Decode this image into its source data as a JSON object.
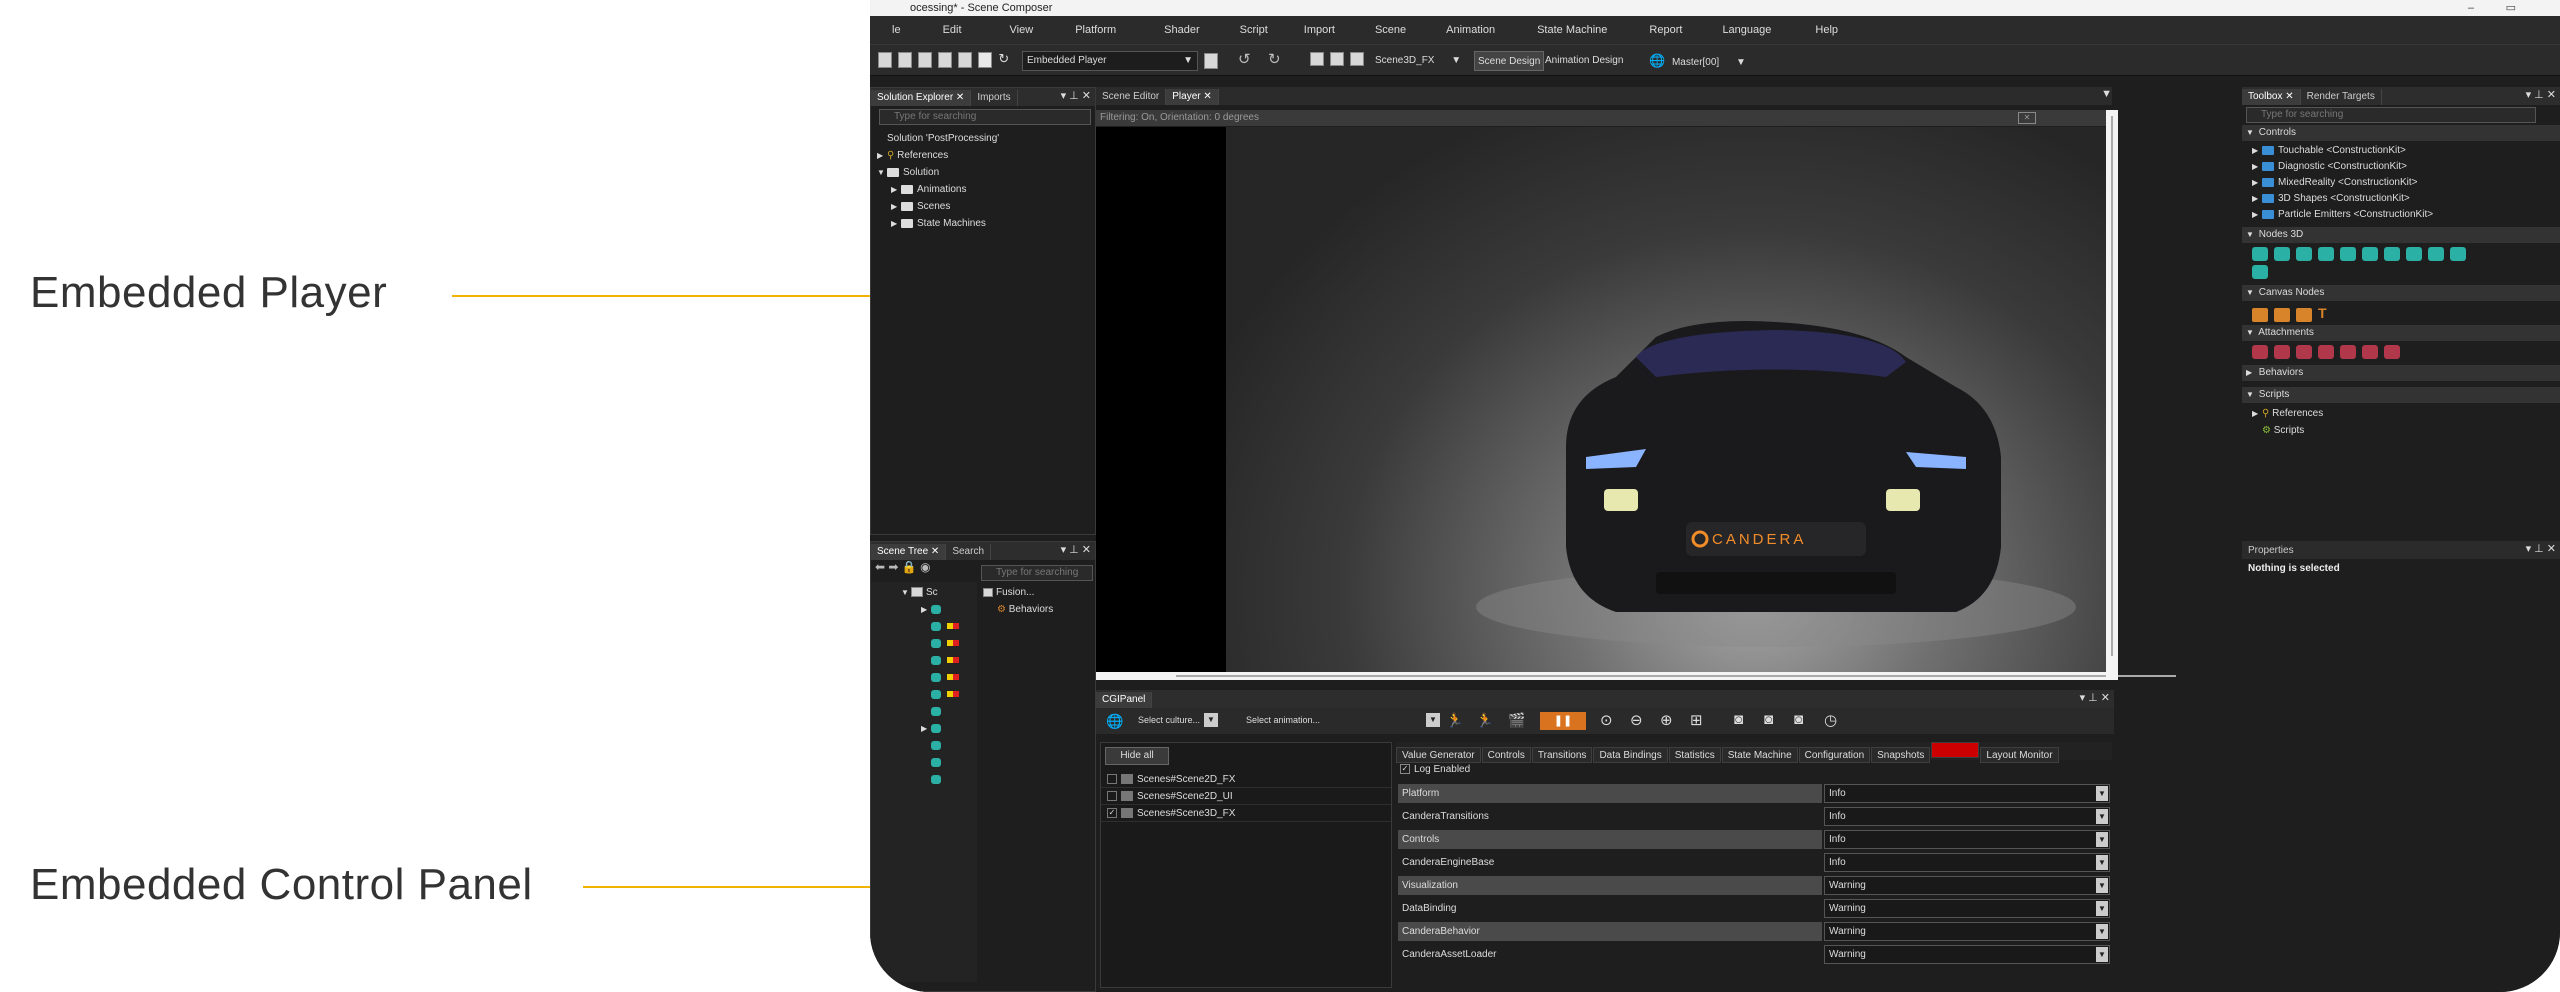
{
  "callouts": {
    "player": "Embedded Player",
    "control_panel": "Embedded Control Panel"
  },
  "window": {
    "title": "ocessing* - Scene Composer",
    "menu": [
      "le",
      "Edit",
      "View",
      "Platform",
      "Shader",
      "Script",
      "Import",
      "Scene",
      "Animation",
      "State Machine",
      "Report",
      "Language",
      "Help"
    ],
    "toolbar": {
      "player_select": "Embedded Player",
      "scene_select": "Scene3D_FX",
      "scene_design": "Scene Design",
      "animation_design": "Animation Design",
      "master_select": "Master[00]"
    }
  },
  "solution_explorer": {
    "tabs": [
      "Solution Explorer",
      "Imports"
    ],
    "search_placeholder": "Type for searching",
    "items": [
      {
        "label": "Solution 'PostProcessing'"
      },
      {
        "label": "References"
      },
      {
        "label": "Solution"
      },
      {
        "label": "Animations"
      },
      {
        "label": "Scenes"
      },
      {
        "label": "State Machines"
      }
    ]
  },
  "scene_tree": {
    "tabs": [
      "Scene Tree",
      "Search"
    ],
    "search_placeholder": "Type for searching",
    "root_label": "Sc",
    "right_items": [
      "Fusion...",
      "Behaviors"
    ]
  },
  "editor": {
    "tabs": [
      "Scene Editor",
      "Player"
    ],
    "filter_text": "Filtering: On, Orientation: 0 degrees",
    "car_brand": "CANDERA"
  },
  "cgi_panel": {
    "title": "CGIPanel",
    "culture_placeholder": "Select culture...",
    "animation_placeholder": "Select animation...",
    "hide_all": "Hide all",
    "scenes": [
      {
        "label": "Scenes#Scene2D_FX",
        "checked": false
      },
      {
        "label": "Scenes#Scene2D_UI",
        "checked": false
      },
      {
        "label": "Scenes#Scene3D_FX",
        "checked": true
      }
    ],
    "view_tabs": [
      "Value Generator",
      "Controls",
      "Transitions",
      "Data Bindings",
      "Statistics",
      "State Machine",
      "Configuration",
      "Snapshots",
      "",
      "Layout Monitor"
    ],
    "log_enabled": "Log Enabled",
    "log_rows": [
      {
        "key": "Platform",
        "value": "Info"
      },
      {
        "key": "CanderaTransitions",
        "value": "Info"
      },
      {
        "key": "Controls",
        "value": "Info"
      },
      {
        "key": "CanderaEngineBase",
        "value": "Info"
      },
      {
        "key": "Visualization",
        "value": "Warning"
      },
      {
        "key": "DataBinding",
        "value": "Warning"
      },
      {
        "key": "CanderaBehavior",
        "value": "Warning"
      },
      {
        "key": "CanderaAssetLoader",
        "value": "Warning"
      }
    ]
  },
  "toolbox": {
    "tabs": [
      "Toolbox",
      "Render Targets"
    ],
    "search_placeholder": "Type for searching",
    "controls_header": "Controls",
    "controls": [
      "Touchable <ConstructionKit>",
      "Diagnostic <ConstructionKit>",
      "MixedReality <ConstructionKit>",
      "3D Shapes <ConstructionKit>",
      "Particle Emitters <ConstructionKit>"
    ],
    "nodes3d_header": "Nodes 3D",
    "canvas_header": "Canvas Nodes",
    "attachments_header": "Attachments",
    "behaviors_header": "Behaviors",
    "scripts_header": "Scripts",
    "scripts_items": [
      "References",
      "Scripts"
    ]
  },
  "properties": {
    "title": "Properties",
    "status": "Nothing is selected"
  },
  "colors": {
    "accent": "#f0b400",
    "panel_bg": "#1e1e1e",
    "record_orange": "#d9731f"
  }
}
